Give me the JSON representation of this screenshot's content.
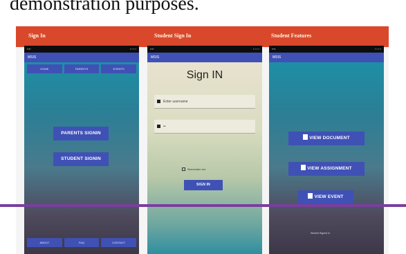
{
  "caption": "demonstration purposes.",
  "columns": {
    "sign_in": "Sign In",
    "student_sign_in": "Student Sign In",
    "student_features": "Student Features"
  },
  "phone1": {
    "appbar_title": "MSIS",
    "top_tabs": [
      "HOME",
      "PARENTS",
      "EVENTS"
    ],
    "parents_signin": "PARENTS SIGNIN",
    "student_signin": "STUDENT SIGNIN",
    "bottom_tabs": [
      "ABOUT",
      "FAQ",
      "CONTACT"
    ]
  },
  "phone2": {
    "appbar_title": "MSIS",
    "heading": "Sign IN",
    "username_placeholder": "Enter username",
    "password_placeholder": "••",
    "remember": "Remember me",
    "signin_button": "SIGN IN"
  },
  "phone3": {
    "appbar_title": "MSIS",
    "view_document": "VIEW DOCUMENT",
    "view_assignment": "VIEW ASSIGNMENT",
    "view_event": "VIEW EVENT",
    "footer": "Student Signed In"
  },
  "colors": {
    "header": "#d9482b",
    "primary": "#3f51b5",
    "divider": "#7a3e9d"
  }
}
